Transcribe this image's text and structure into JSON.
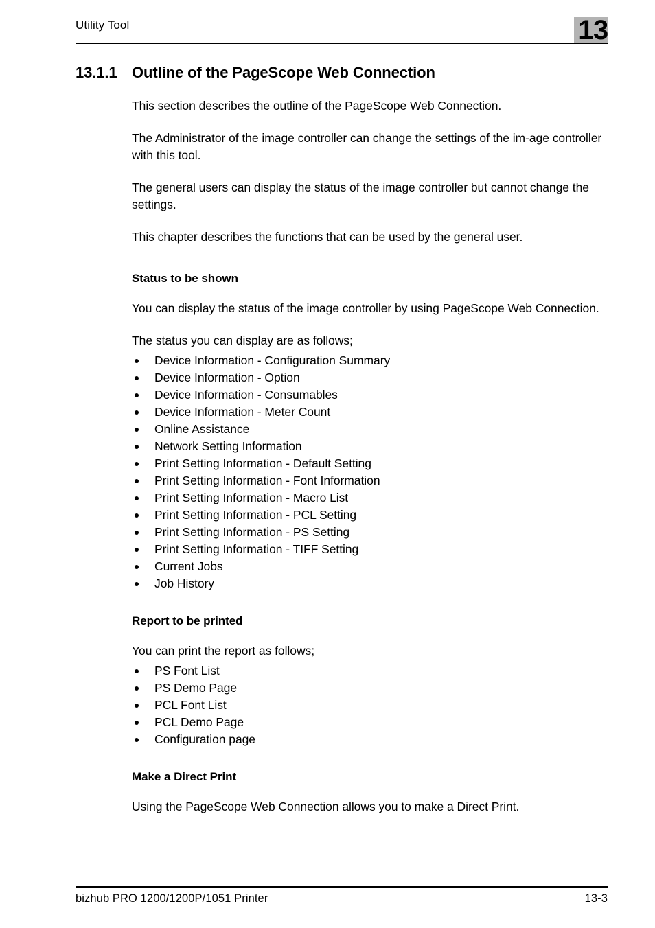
{
  "header": {
    "running_title": "Utility Tool",
    "chapter_number": "13",
    "chapter_tab_color": "#b3b3b3"
  },
  "section": {
    "number": "13.1.1",
    "title": "Outline of the PageScope Web Connection"
  },
  "intro_paragraphs": [
    "This section describes the outline of the PageScope Web Connection.",
    "The Administrator of the image controller can change the settings of the im-age controller with this tool.",
    "The general users can display the status of the image controller but cannot change the settings.",
    "This chapter describes the functions that can be used by the general user."
  ],
  "status_section": {
    "heading": "Status to be shown",
    "paragraph": "You can display the status of the image controller by using PageScope Web Connection.",
    "list_lead": "The status you can display are as follows;",
    "items": [
      "Device Information - Configuration Summary",
      "Device Information - Option",
      "Device Information - Consumables",
      "Device Information - Meter Count",
      "Online Assistance",
      "Network Setting Information",
      "Print Setting Information - Default Setting",
      "Print Setting Information - Font Information",
      "Print Setting Information - Macro List",
      "Print Setting Information - PCL Setting",
      "Print Setting Information - PS Setting",
      "Print Setting Information - TIFF Setting",
      "Current Jobs",
      "Job History"
    ]
  },
  "report_section": {
    "heading": "Report to be printed",
    "list_lead": "You can print the report as follows;",
    "items": [
      "PS Font List",
      "PS Demo Page",
      "PCL Font List",
      "PCL Demo Page",
      "Configuration page"
    ]
  },
  "direct_print_section": {
    "heading": "Make a Direct Print",
    "paragraph": "Using the PageScope Web Connection allows you to make a Direct Print."
  },
  "footer": {
    "product": "bizhub PRO 1200/1200P/1051 Printer",
    "page_number": "13-3"
  }
}
